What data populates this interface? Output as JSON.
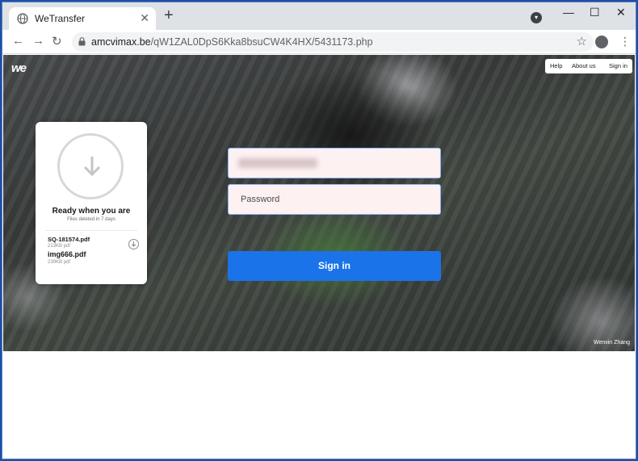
{
  "browser": {
    "tab_title": "WeTransfer",
    "tab_close": "✕",
    "new_tab": "+",
    "window_controls": {
      "minimize": "—",
      "maximize": "☐",
      "close": "✕"
    },
    "nav": {
      "back": "←",
      "forward": "→",
      "reload": "↻"
    },
    "url_host": "amcvimax.be",
    "url_path": "/qW1ZAL0DpS6Kka8bsuCW4K4HX/5431173.php",
    "star": "☆",
    "menu": "⋮"
  },
  "page": {
    "logo": "we",
    "topnav": {
      "help": "Help",
      "about": "About us",
      "signin": "Sign in"
    },
    "card": {
      "ready_title": "Ready when you are",
      "deleted_note": "Files deleted in 7 days",
      "files": [
        {
          "name": "SQ-181574.pdf",
          "size": "213KB pdf"
        },
        {
          "name": "img666.pdf",
          "size": "239KB pdf"
        }
      ]
    },
    "form": {
      "password_placeholder": "Password",
      "signin_label": "Sign in"
    },
    "photo_credit": "Wenxin Zhang"
  },
  "colors": {
    "accent": "#1a73e8",
    "field_bg": "#fdf1f1"
  }
}
